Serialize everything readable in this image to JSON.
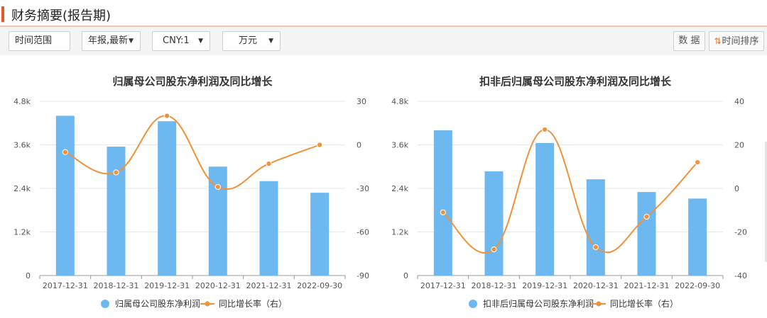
{
  "header": {
    "title": "财务摘要(报告期)"
  },
  "toolbar": {
    "time_range_label": "时间范围",
    "period_select": "年报,最新",
    "currency_select": "CNY:1",
    "unit_select": "万元",
    "data_button": "数 据",
    "sort_button": "时间排序",
    "caret_icon": "triangle-down-icon",
    "sort_icon": "up-down-arrows-icon"
  },
  "colors": {
    "bar": "#6db8f0",
    "line": "#f0923a",
    "accent": "#e8562a"
  },
  "chart_data": [
    {
      "type": "bar",
      "title": "归属母公司股东净利润及同比增长",
      "categories": [
        "2017-12-31",
        "2018-12-31",
        "2019-12-31",
        "2020-12-31",
        "2021-12-31",
        "2022-09-30"
      ],
      "series": [
        {
          "name": "归属母公司股东净利润",
          "type": "bar",
          "axis": "left",
          "values": [
            4400,
            3550,
            4250,
            3000,
            2600,
            2280
          ]
        },
        {
          "name": "同比增长率（右）",
          "type": "line",
          "axis": "right",
          "smooth": true,
          "values": [
            -5,
            -19,
            20,
            -29,
            -13,
            0
          ]
        }
      ],
      "y_left": {
        "ticks": [
          "0",
          "1.2k",
          "2.4k",
          "3.6k",
          "4.8k"
        ],
        "ylim": [
          0,
          4800
        ]
      },
      "y_right": {
        "ticks": [
          "-90",
          "-60",
          "-30",
          "0",
          "30"
        ],
        "ylim": [
          -90,
          30
        ]
      },
      "grid": true,
      "legend_position": "bottom"
    },
    {
      "type": "bar",
      "title": "扣非后归属母公司股东净利润及同比增长",
      "categories": [
        "2017-12-31",
        "2018-12-31",
        "2019-12-31",
        "2020-12-31",
        "2021-12-31",
        "2022-09-30"
      ],
      "series": [
        {
          "name": "扣非后归属母公司股东净利润",
          "type": "bar",
          "axis": "left",
          "values": [
            4000,
            2870,
            3650,
            2650,
            2300,
            2120
          ]
        },
        {
          "name": "同比增长率（右）",
          "type": "line",
          "axis": "right",
          "smooth": true,
          "values": [
            -11,
            -28,
            27,
            -27,
            -13,
            12
          ]
        }
      ],
      "y_left": {
        "ticks": [
          "0",
          "1.2k",
          "2.4k",
          "3.6k",
          "4.8k"
        ],
        "ylim": [
          0,
          4800
        ]
      },
      "y_right": {
        "ticks": [
          "-40",
          "-20",
          "0",
          "20",
          "40"
        ],
        "ylim": [
          -40,
          40
        ]
      },
      "grid": true,
      "legend_position": "bottom"
    }
  ]
}
